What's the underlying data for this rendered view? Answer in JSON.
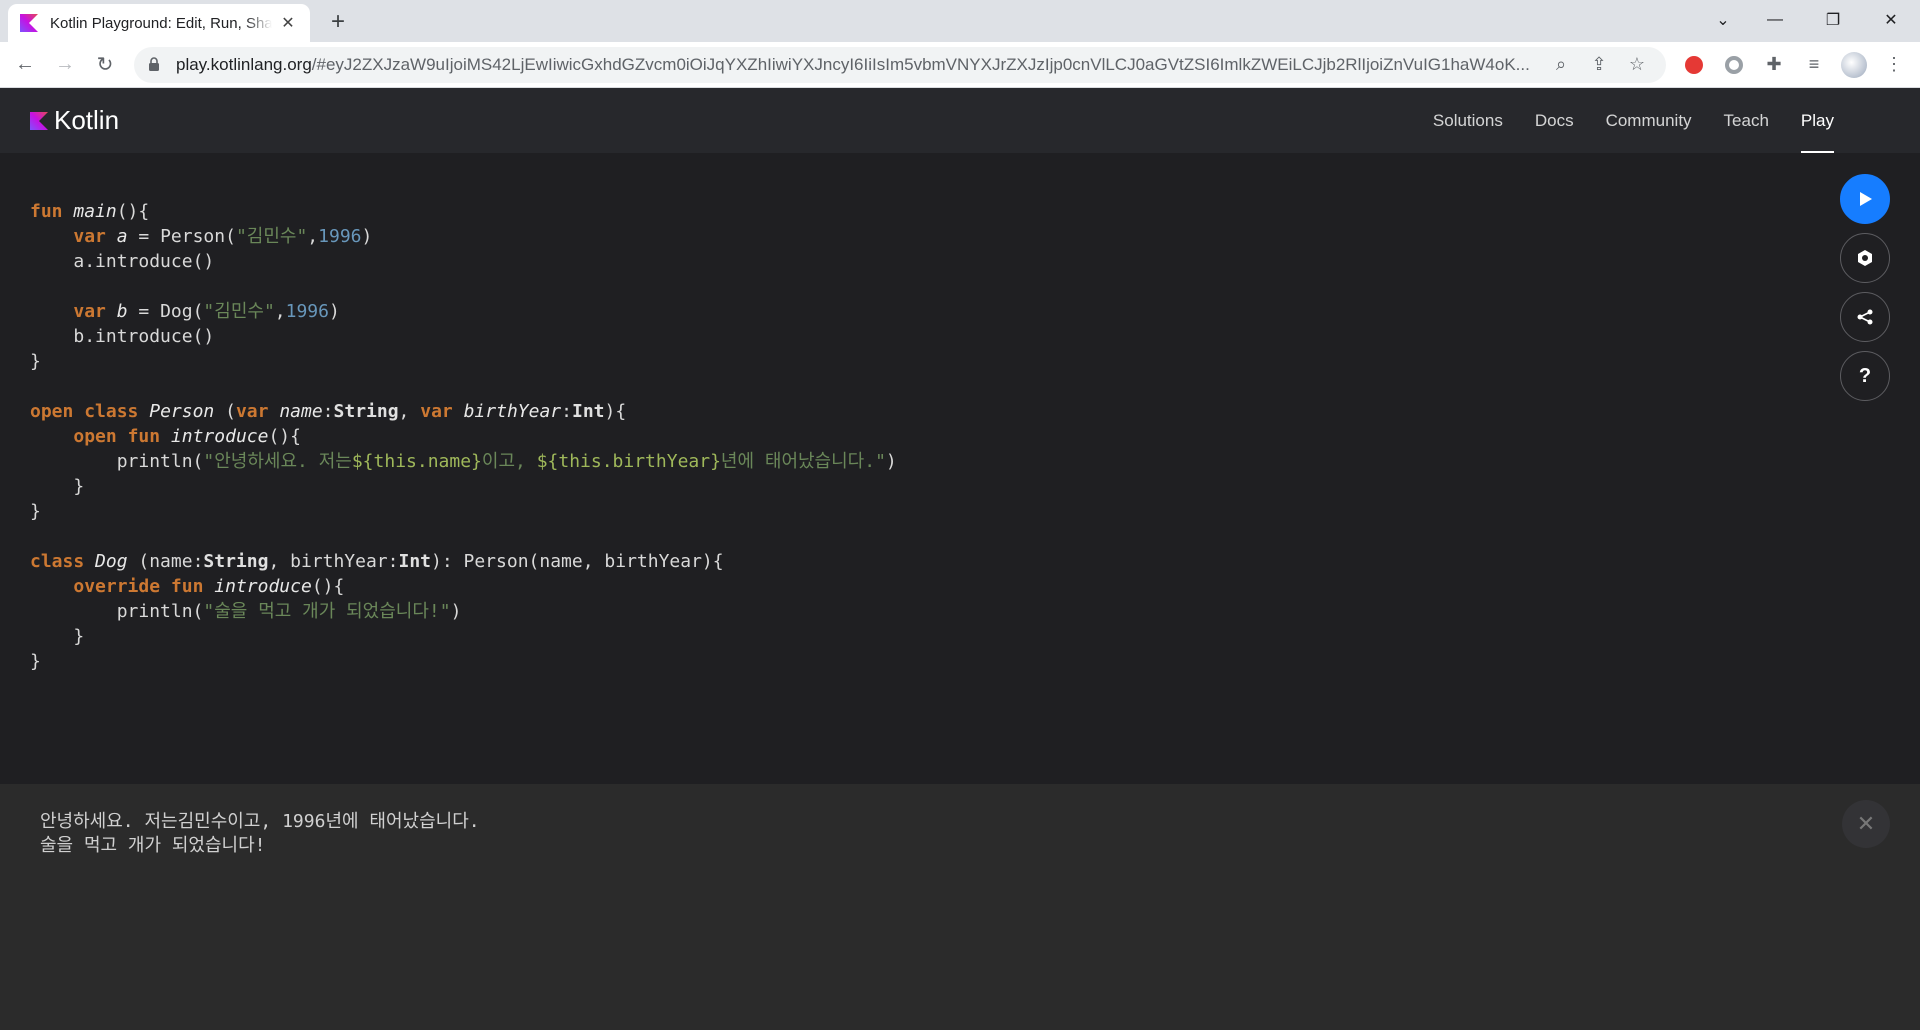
{
  "browser": {
    "tab_title": "Kotlin Playground: Edit, Run, Share Kotlin Code Online",
    "url_host": "play.kotlinlang.org",
    "url_rest": "/#eyJ2ZXJzaW9uIjoiMS42LjEwIiwicGxhdGZvcm0iOiJqYXZhIiwiYXJncyI6IiIsIm5vbmVNYXJrZXJzIjp0cnVlLCJ0aGVtZSI6ImlkZWEiLCJjb2RlIjoiZnVuIG1haW4oK..."
  },
  "site": {
    "brand": "Kotlin",
    "nav": [
      "Solutions",
      "Docs",
      "Community",
      "Teach",
      "Play"
    ],
    "active_nav": "Play"
  },
  "code": {
    "main_kw": "fun",
    "main_name": "main",
    "main_rest": "(){",
    "var_kw": "var",
    "var_a": "a",
    "person_call": " = Person(",
    "name_str": "\"김민수\"",
    "year": "1996",
    "a_intro": "a.introduce()",
    "var_b": "b",
    "dog_call": " = Dog(",
    "b_intro": "b.introduce()",
    "close_brace": "}",
    "open_kw": "open",
    "class_kw": "class",
    "person_name": "Person",
    "paren_open": " (",
    "name_param": "name",
    "string_type": "String",
    "birthyear_param": "birthYear",
    "int_type": "Int",
    "introduce_name": "introduce",
    "println": "println(",
    "greet_pre": "\"안녕하세요. 저는",
    "tpl_name": "${this.name}",
    "greet_mid": "이고, ",
    "tpl_year": "${this.birthYear}",
    "greet_post": "년에 태어났습니다.\"",
    "dog_name": "Dog",
    "dog_params": " (name:",
    "dog_after": ", birthYear:",
    "dog_super": "): Person(name, birthYear){",
    "override_kw": "override",
    "dog_str": "\"술을 먹고 개가 되었습니다!\""
  },
  "output": {
    "line1_pre": "안녕하세요. 저는김민수이고, ",
    "line1_year": "1996",
    "line1_post": "년에 태어났습니다.",
    "line2": "술을 먹고 개가 되었습니다!"
  },
  "icons": {
    "run": "play-icon",
    "settings": "hexagon-icon",
    "share": "share-icon",
    "help": "question-icon",
    "close": "close-icon"
  },
  "colors": {
    "run_button": "#167dff",
    "keyword": "#cc7832",
    "string": "#6a8759",
    "number": "#6897bb"
  }
}
